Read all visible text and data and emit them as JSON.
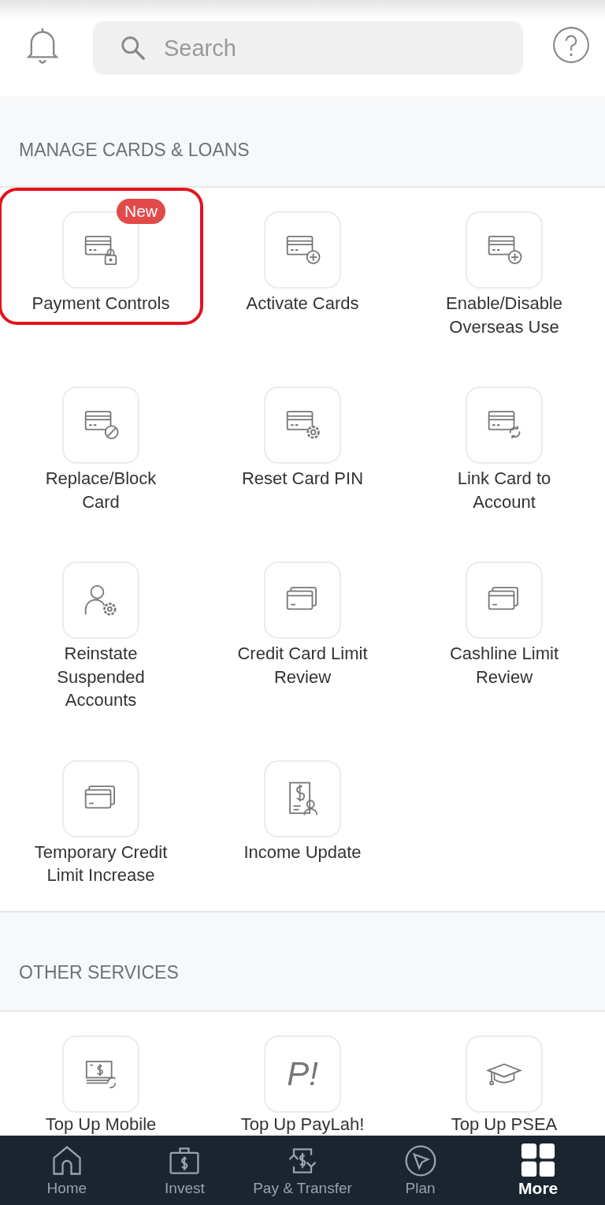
{
  "header": {
    "search": {
      "placeholder": "Search"
    }
  },
  "sections": [
    {
      "title": "MANAGE CARDS & LOANS",
      "items": [
        {
          "kind": "card-lock",
          "label": "Payment Controls",
          "badge": "New",
          "highlighted": true
        },
        {
          "kind": "card-plus",
          "label": "Activate Cards",
          "highlighted": false
        },
        {
          "kind": "card-plus",
          "label": "Enable/Disable Overseas Use",
          "highlighted": false
        },
        {
          "kind": "card-block",
          "label": "Replace/Block Card",
          "highlighted": false
        },
        {
          "kind": "card-gear",
          "label": "Reset Card PIN",
          "highlighted": false
        },
        {
          "kind": "card-sync",
          "label": "Link Card to Account",
          "highlighted": false
        },
        {
          "kind": "person-gear",
          "label": "Reinstate Suspended Accounts",
          "highlighted": false
        },
        {
          "kind": "cards",
          "label": "Credit Card Limit Review",
          "highlighted": false
        },
        {
          "kind": "cards",
          "label": "Cashline Limit Review",
          "highlighted": false
        },
        {
          "kind": "cards",
          "label": "Temporary Credit Limit Increase",
          "highlighted": false
        },
        {
          "kind": "document-person",
          "label": "Income Update",
          "highlighted": false
        }
      ]
    },
    {
      "title": "OTHER SERVICES",
      "items": [
        {
          "kind": "cash-sync",
          "label": "Top Up Mobile",
          "highlighted": false
        },
        {
          "kind": "text",
          "icon_text": "P!",
          "label": "Top Up PayLah!",
          "highlighted": false
        },
        {
          "kind": "cap",
          "label": "Top Up PSEA",
          "highlighted": false
        }
      ]
    }
  ],
  "nav": [
    {
      "kind": "home",
      "label": "Home",
      "selected": false
    },
    {
      "kind": "invest",
      "label": "Invest",
      "selected": false
    },
    {
      "kind": "transfer",
      "label": "Pay & Transfer",
      "selected": false
    },
    {
      "kind": "plan",
      "label": "Plan",
      "selected": false
    },
    {
      "kind": "more",
      "label": "More",
      "selected": true
    }
  ]
}
